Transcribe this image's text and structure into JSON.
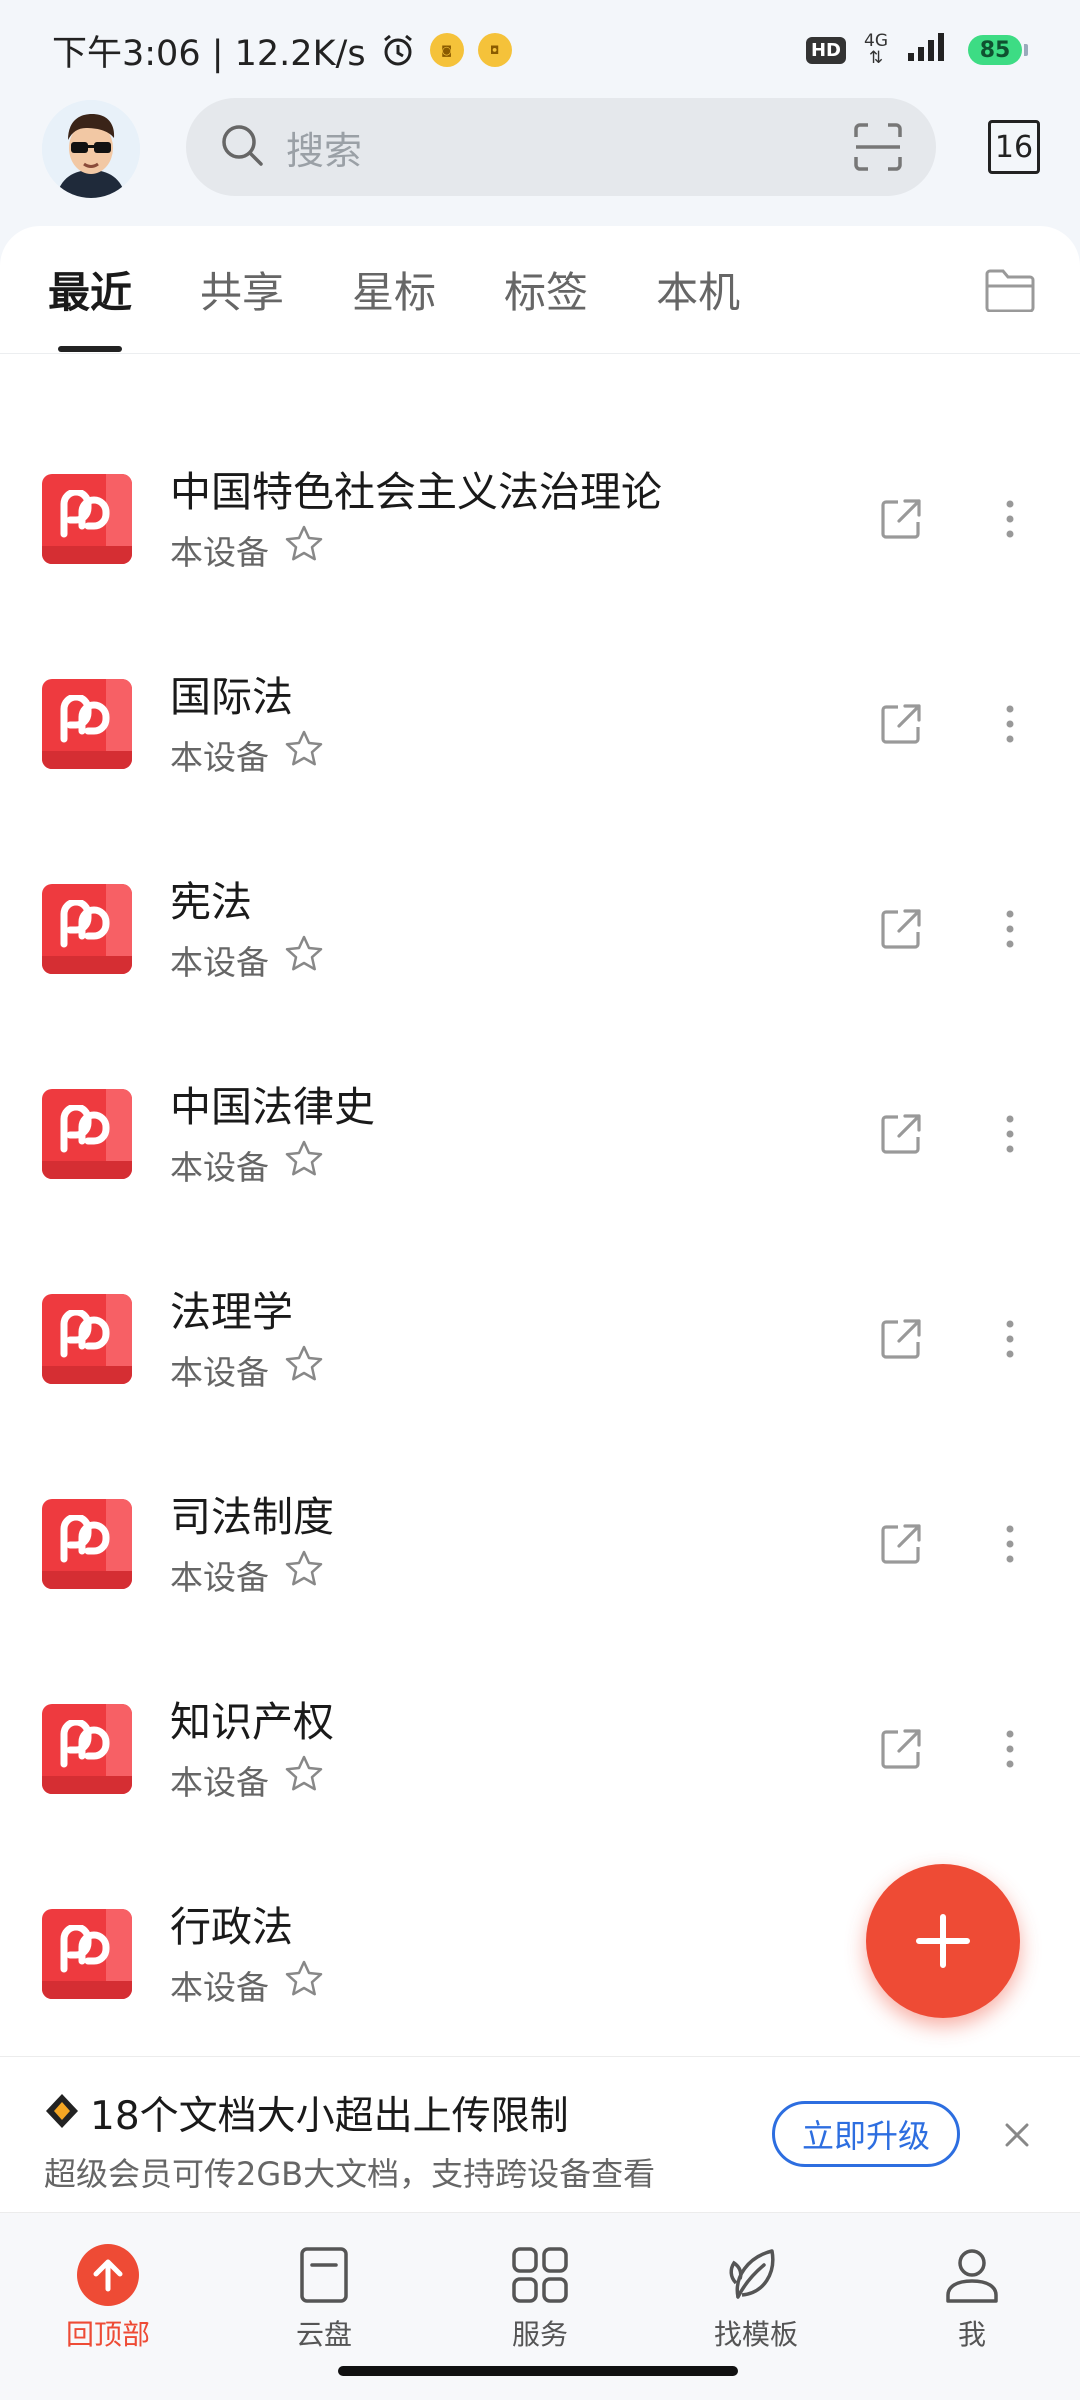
{
  "status_bar": {
    "time_speed": "下午3:06 | 12.2K/s",
    "hd": "HD",
    "network": "4G",
    "battery": "85"
  },
  "header": {
    "search_placeholder": "搜索",
    "calendar_day": "16"
  },
  "tabs": [
    {
      "label": "最近",
      "active": true
    },
    {
      "label": "共享",
      "active": false
    },
    {
      "label": "星标",
      "active": false
    },
    {
      "label": "标签",
      "active": false
    },
    {
      "label": "本机",
      "active": false
    }
  ],
  "files": [
    {
      "name": "中国特色社会主义法治理论",
      "location": "本设备"
    },
    {
      "name": "国际法",
      "location": "本设备"
    },
    {
      "name": "宪法",
      "location": "本设备"
    },
    {
      "name": "中国法律史",
      "location": "本设备"
    },
    {
      "name": "法理学",
      "location": "本设备"
    },
    {
      "name": "司法制度",
      "location": "本设备"
    },
    {
      "name": "知识产权",
      "location": "本设备"
    },
    {
      "name": "行政法",
      "location": "本设备"
    }
  ],
  "banner": {
    "title": "18个文档大小超出上传限制",
    "subtitle": "超级会员可传2GB大文档，支持跨设备查看",
    "button": "立即升级"
  },
  "bottom_nav": [
    {
      "label": "回顶部",
      "icon": "arrow-up-icon",
      "active": true
    },
    {
      "label": "云盘",
      "icon": "cloud-disk-icon",
      "active": false
    },
    {
      "label": "服务",
      "icon": "grid-icon",
      "active": false
    },
    {
      "label": "找模板",
      "icon": "leaf-icon",
      "active": false
    },
    {
      "label": "我",
      "icon": "person-icon",
      "active": false
    }
  ],
  "colors": {
    "accent": "#ee4b35",
    "pdf_red": "#ee3a3f",
    "upgrade_blue": "#2d6ee0",
    "battery_green": "#3ddc84"
  }
}
